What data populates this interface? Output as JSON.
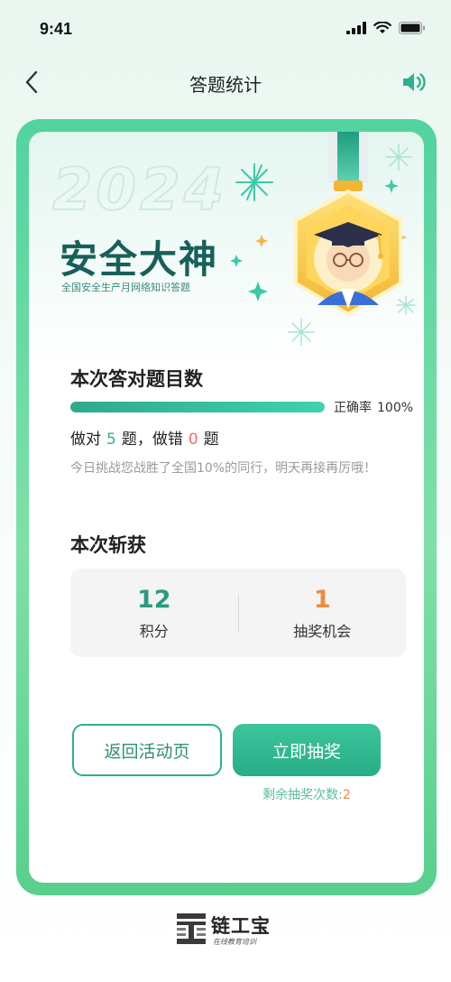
{
  "status_bar": {
    "time": "9:41",
    "icons": [
      "signal-icon",
      "wifi-icon",
      "battery-icon"
    ]
  },
  "nav": {
    "title": "答题统计",
    "back_icon": "chevron-left-icon",
    "speaker_icon": "speaker-icon"
  },
  "hero": {
    "year": "2024",
    "title": "安全大神",
    "subtitle": "全国安全生产月网络知识答题"
  },
  "result": {
    "section_title": "本次答对题目数",
    "progress_fraction": 1.0,
    "rate_label": "正确率",
    "rate_value": "100%",
    "correct_prefix": "做对",
    "correct_count": "5",
    "correct_unit": "题，做错",
    "wrong_count": "0",
    "wrong_unit": "题",
    "encourage_text": "今日挑战您战胜了全国10%的同行，明天再接再厉哦！"
  },
  "rewards": {
    "section_title": "本次斩获",
    "items": [
      {
        "value": "12",
        "label": "积分",
        "color": "#2a9a80"
      },
      {
        "value": "1",
        "label": "抽奖机会",
        "color": "#f08a3c"
      }
    ]
  },
  "actions": {
    "back_label": "返回活动页",
    "draw_label": "立即抽奖",
    "remaining_label": "剩余抽奖次数:",
    "remaining_count": "2"
  },
  "footer": {
    "brand_name": "链工宝",
    "brand_slogan": "在线教育培训"
  },
  "colors": {
    "primary": "#2db08f",
    "accent_orange": "#f08a3c",
    "error_red": "#f26b6b",
    "title_dark_green": "#17605a"
  }
}
